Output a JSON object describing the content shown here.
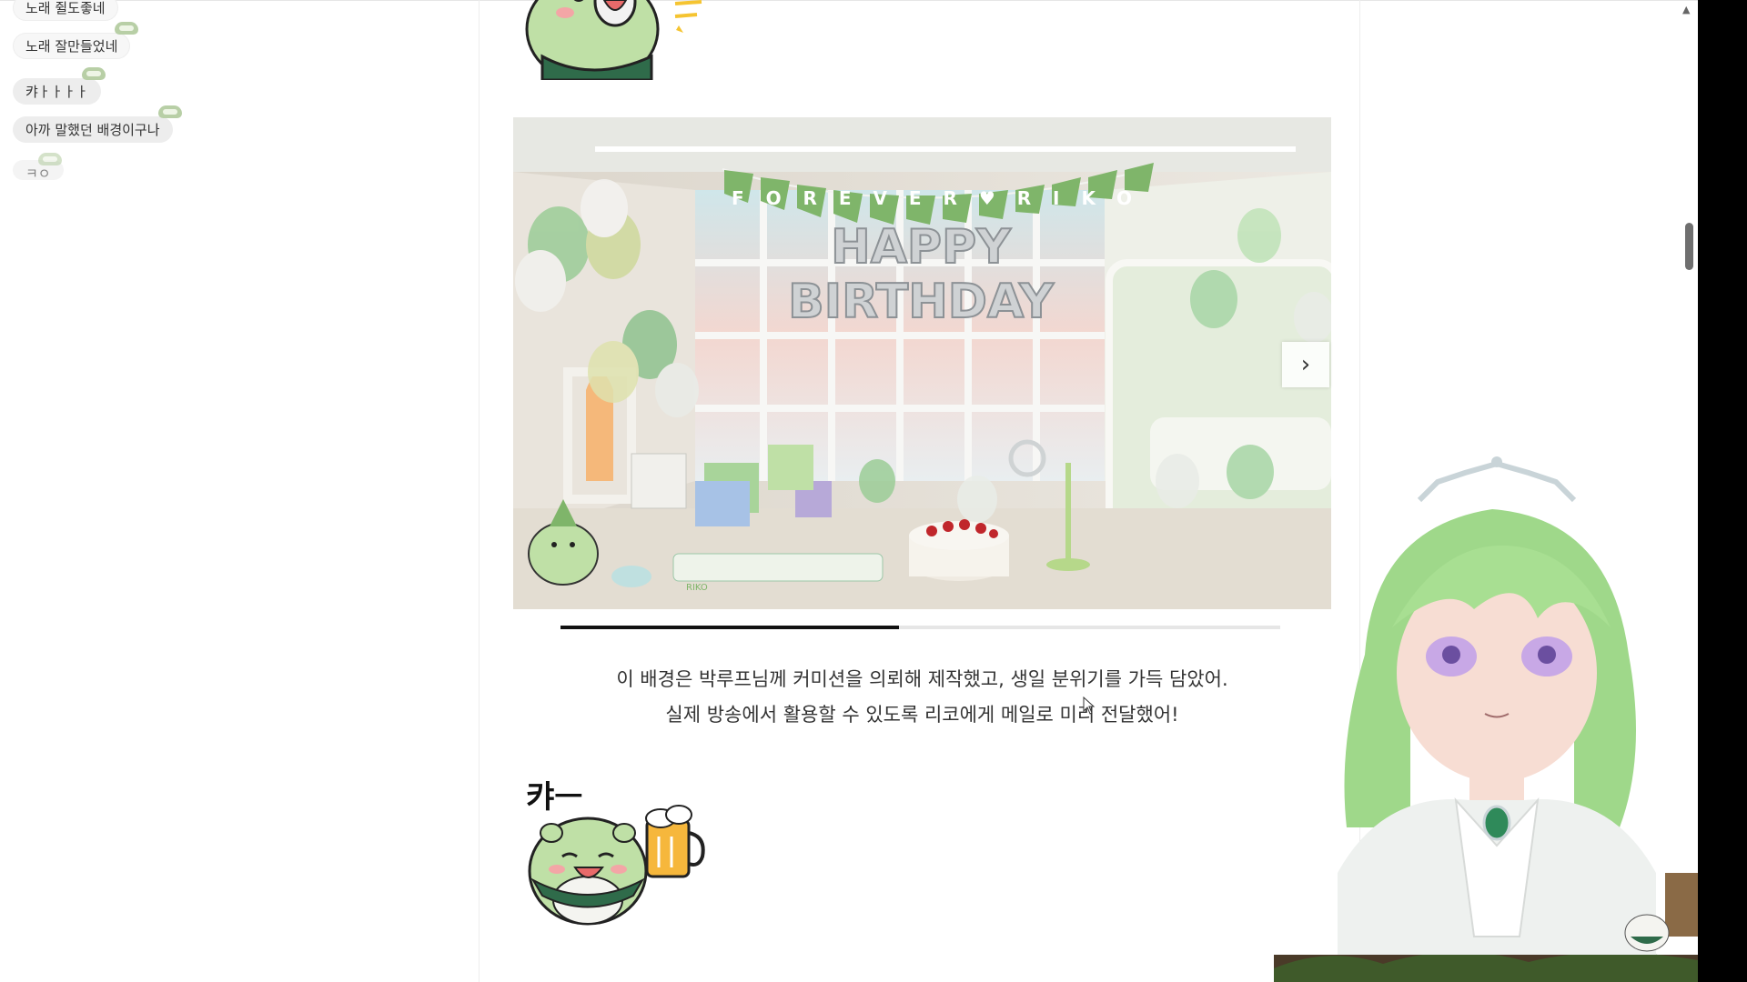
{
  "chat": {
    "messages": [
      {
        "text": "노래 쥘도좋네"
      },
      {
        "text": "노래 잘만들었네"
      },
      {
        "text": "캬ㅏㅏㅏㅏ"
      },
      {
        "text": "아까 말했던 배경이구나"
      },
      {
        "text": "ㅋㅇ"
      }
    ]
  },
  "slideshow": {
    "garland_text": "FOREVER♥RIKO",
    "banner_line1": "HAPPY",
    "banner_line2": "BIRTHDAY",
    "keyboard_label": "RIKO",
    "progress_fraction": 0.47,
    "next_icon": "chevron-right-icon",
    "next_glyph": "›"
  },
  "caption": {
    "line1": "이 배경은 박루프님께 커미션을 의뢰해 제작했고, 생일 분위기를 가득 담았어.",
    "line2": "실제 방송에서 활용할 수 있도록 리코에게 메일로 미리 전달했어!"
  },
  "sticker": {
    "kya_text": "캬ㅡ"
  },
  "colors": {
    "accent_green": "#7fb56a",
    "progress": "#111111"
  }
}
